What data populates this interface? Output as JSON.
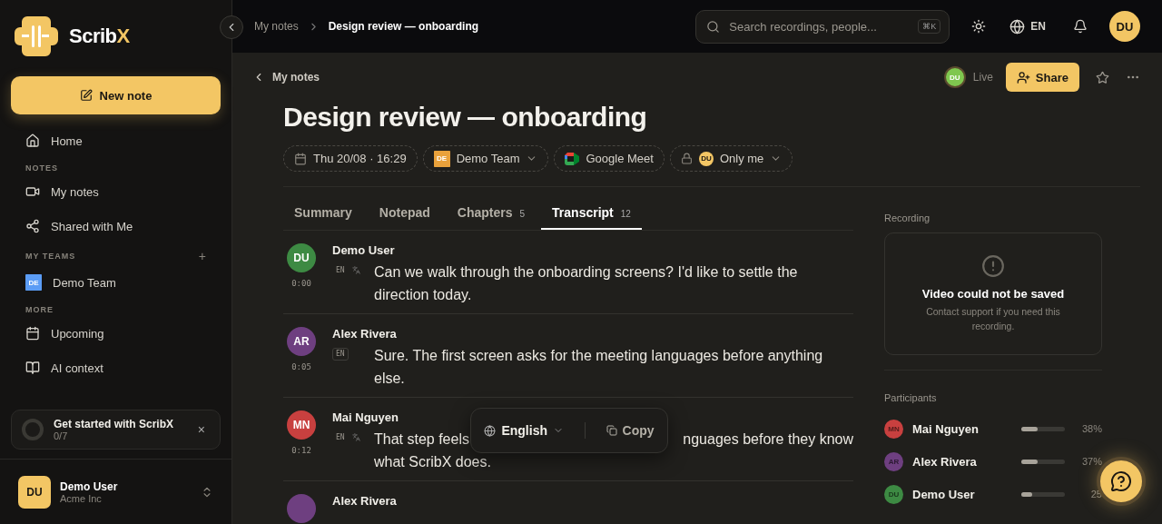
{
  "brand": {
    "name_main": "Scrib",
    "name_accent": "X"
  },
  "new_note": "New note",
  "sidebar": {
    "items": [
      {
        "kind": "link",
        "label": "Home",
        "selected": false
      },
      {
        "kind": "section",
        "label": "NOTES"
      },
      {
        "kind": "link",
        "label": "My notes",
        "selected": false
      },
      {
        "kind": "link",
        "label": "Shared with Me",
        "selected": false
      },
      {
        "kind": "section",
        "label": "MY TEAMS",
        "add": "+"
      },
      {
        "kind": "team",
        "label": "Demo Team",
        "badge": "DE",
        "selected": false
      },
      {
        "kind": "section",
        "label": "MORE"
      },
      {
        "kind": "link",
        "label": "Upcoming",
        "selected": false
      },
      {
        "kind": "link",
        "label": "AI context",
        "selected": false
      }
    ],
    "onboarding": {
      "title": "Get started with ScribX",
      "progress": "0/7",
      "level": 0,
      "close": "×"
    },
    "user": {
      "initials": "DU",
      "name": "Demo User",
      "org": "Acme Inc"
    }
  },
  "topbar": {
    "breadcrumbs": [
      {
        "label": "My notes",
        "current": false
      },
      {
        "label": "Design review — onboarding",
        "current": true
      }
    ],
    "search": {
      "placeholder": "Search recordings, people...",
      "shortcut": "⌘K"
    },
    "language": "EN",
    "avatar": "DU"
  },
  "note": {
    "back": "My notes",
    "live": {
      "initials": "DU",
      "label": "Live"
    },
    "share": "Share",
    "title": "Design review — onboarding",
    "chips": [
      {
        "kind": "date",
        "label": "Thu 20/08 · 16:29"
      },
      {
        "kind": "team",
        "badge": "DE",
        "label": "Demo Team"
      },
      {
        "kind": "meet",
        "label": "Google Meet"
      },
      {
        "kind": "access",
        "badge": "DU",
        "label": "Only me"
      }
    ],
    "tabs": [
      {
        "label": "Summary",
        "selected": false
      },
      {
        "label": "Notepad",
        "selected": false
      },
      {
        "label": "Chapters",
        "count": "5",
        "selected": false
      },
      {
        "label": "Transcript",
        "count": "12",
        "selected": true
      }
    ],
    "transcript": [
      {
        "initials": "DU",
        "color": "#3d8a43",
        "name": "Demo User",
        "time": "0:00",
        "lang": "EN",
        "translated": true,
        "text": "Can we walk through the onboarding screens? I'd like to settle the direction today."
      },
      {
        "initials": "AR",
        "color": "#6e3f80",
        "name": "Alex Rivera",
        "time": "0:05",
        "lang": "EN",
        "translated": false,
        "text": "Sure. The first screen asks for the meeting languages before anything else."
      },
      {
        "initials": "MN",
        "color": "#c8403f",
        "name": "Mai Nguyen",
        "time": "0:12",
        "lang": "EN",
        "translated": true,
        "text_parts": [
          "That step feels",
          "nguages before they know",
          "what ScribX does."
        ]
      },
      {
        "color": "#6e3f80",
        "name": "Alex Rivera"
      }
    ],
    "toolbar": {
      "language": "English",
      "copy": "Copy"
    },
    "recording": {
      "heading": "Recording",
      "title": "Video could not be saved",
      "message": "Contact support if you need this recording."
    },
    "participants": {
      "heading": "Participants",
      "items": [
        {
          "initials": "MN",
          "color": "#c8403f",
          "name": "Mai Nguyen",
          "level": 0.38,
          "share": "38%"
        },
        {
          "initials": "AR",
          "color": "#6e3f80",
          "name": "Alex Rivera",
          "level": 0.37,
          "share": "37%"
        },
        {
          "initials": "DU",
          "color": "#3d8a43",
          "name": "Demo User",
          "level": 0.25,
          "share": "25"
        }
      ]
    }
  }
}
